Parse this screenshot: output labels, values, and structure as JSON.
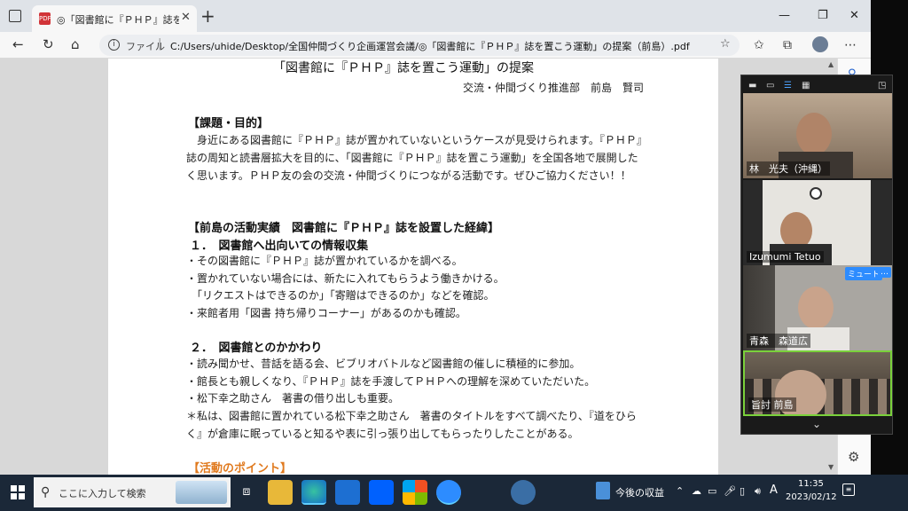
{
  "browser": {
    "tab_title": "◎「図書館に『ＰＨＰ』誌を置こう",
    "file_label": "ファイル",
    "url": "C:/Users/uhide/Desktop/全国仲間づくり企画運営会議/◎「図書館に『ＰＨＰ』誌を置こう運動」の提案（前島）.pdf"
  },
  "document": {
    "title": "「図書館に『ＰＨＰ』誌を置こう運動」の提案",
    "author": "交流・仲間づくり推進部　前島　賢司",
    "section1_heading": "【課題・目的】",
    "section1_body": "　身近にある図書館に『ＰＨＰ』誌が置かれていないというケースが見受けられます。『ＰＨＰ』誌の周知と読書層拡大を目的に、「図書館に『ＰＨＰ』誌を置こう運動」を全国各地で展開したく思います。ＰＨＰ友の会の交流・仲間づくりにつながる活動です。ぜひご協力ください！！",
    "section2_heading": "【前島の活動実績　図書館に『ＰＨＰ』誌を設置した経緯】",
    "sub1": "１．　図書館へ出向いての情報収集",
    "sub1_lines": [
      "・その図書館に『ＰＨＰ』誌が置かれているかを調べる。",
      "・置かれていない場合には、新たに入れてもらうよう働きかける。",
      "　「リクエストはできるのか」「寄贈はできるのか」などを確認。",
      "・来館者用「図書 持ち帰りコーナー」があるのかも確認。"
    ],
    "sub2": "２．　図書館とのかかわり",
    "sub2_lines": [
      "・読み聞かせ、昔話を語る会、ビブリオバトルなど図書館の催しに積極的に参加。",
      "・館長とも親しくなり、『ＰＨＰ』誌を手渡してＰＨＰへの理解を深めていただいた。",
      "・松下幸之助さん　著書の借り出しも重要。",
      "＊私は、図書館に置かれている松下幸之助さん　著書のタイトルをすべて調べたり、『道をひら",
      "く』が倉庫に眠っていると知るや表に引っ張り出してもらったりしたことがある。"
    ],
    "section3_heading": "【活動のポイント】"
  },
  "zoom": {
    "participants": [
      {
        "name": "林　光夫（沖縄）"
      },
      {
        "name": "Izumumi Tetuo"
      },
      {
        "name": "青森　森道広"
      },
      {
        "name": "旨討 前島"
      }
    ],
    "mute_label": "ミュート",
    "more_label": "…"
  },
  "taskbar": {
    "search_placeholder": "ここに入力して検索",
    "news": "今後の収益",
    "ime": "A",
    "time": "11:35",
    "date": "2023/02/12"
  }
}
